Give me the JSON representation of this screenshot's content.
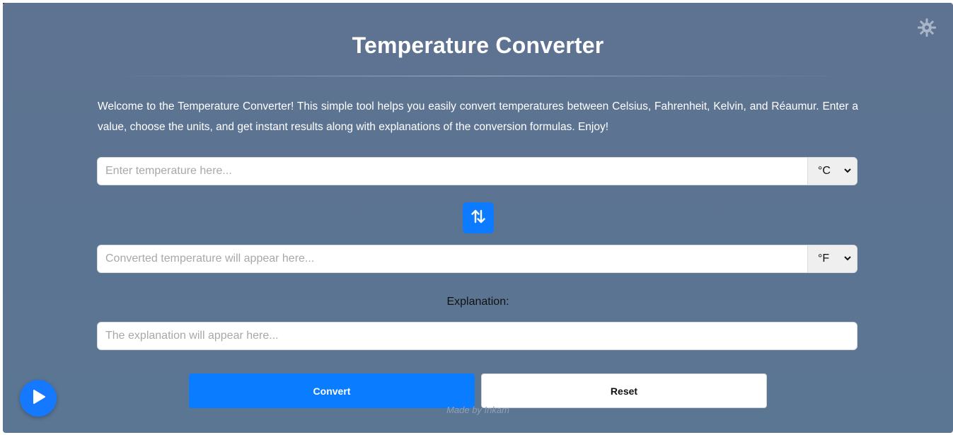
{
  "title": "Temperature Converter",
  "intro": "Welcome to the Temperature Converter! This simple tool helps you easily convert temperatures between Celsius, Fahrenheit, Kelvin, and Réaumur. Enter a value, choose the units, and get instant results along with explanations of the conversion formulas. Enjoy!",
  "input": {
    "placeholder": "Enter temperature here...",
    "value": "",
    "unit": "°C"
  },
  "output": {
    "placeholder": "Converted temperature will appear here...",
    "value": "",
    "unit": "°F"
  },
  "explanation": {
    "label": "Explanation:",
    "placeholder": "The explanation will appear here...",
    "value": ""
  },
  "buttons": {
    "convert": "Convert",
    "reset": "Reset"
  },
  "footer": {
    "made_by": "Made by Inkam"
  },
  "icons": {
    "settings": "settings-icon",
    "swap": "swap-arrows-icon",
    "play": "play-icon",
    "dropdown": "chevron-down-icon"
  },
  "colors": {
    "accent": "#0a7cff",
    "background": "#5e7391"
  }
}
